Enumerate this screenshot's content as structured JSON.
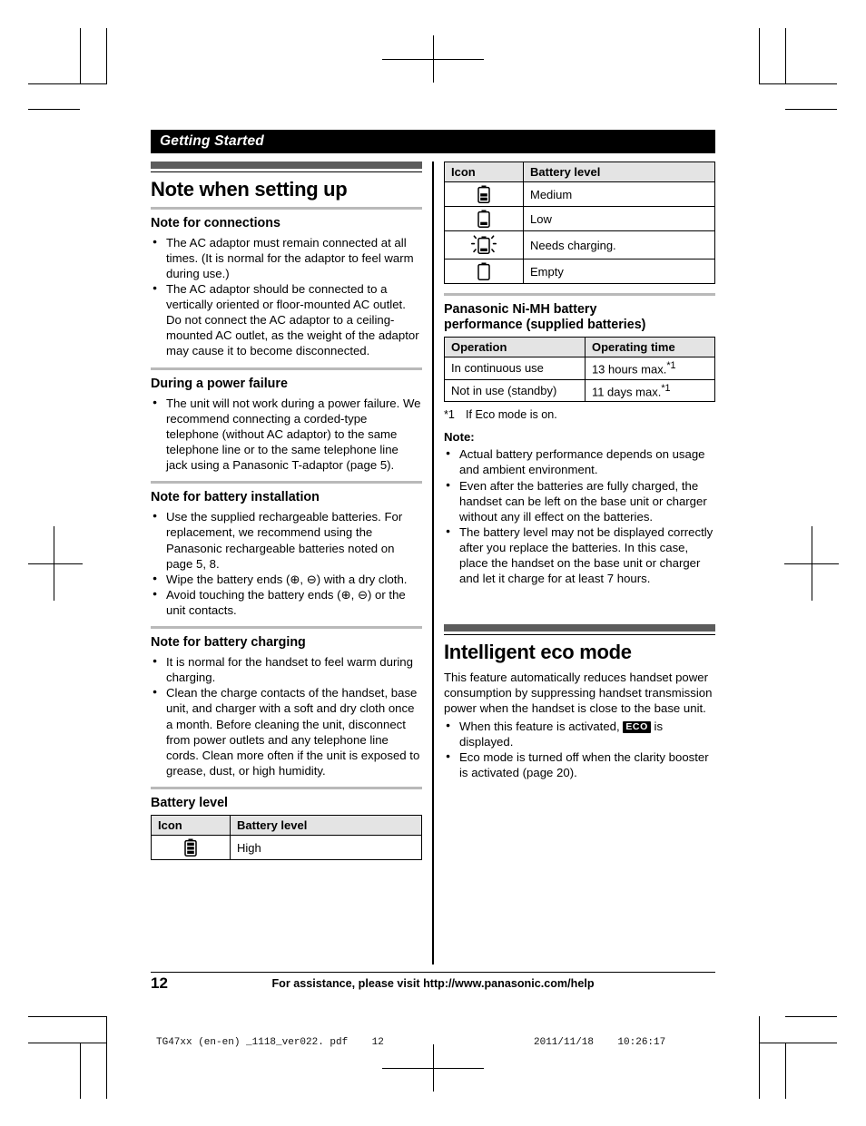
{
  "chapter": {
    "title": "Getting Started"
  },
  "left_column": {
    "section": {
      "title": "Note when setting up",
      "subsections": [
        {
          "heading": "Note for connections",
          "bullets": [
            "The AC adaptor must remain connected at all times. (It is normal for the adaptor to feel warm during use.)",
            "The AC adaptor should be connected to a vertically oriented or floor-mounted AC outlet. Do not connect the AC adaptor to a ceiling-mounted AC outlet, as the weight of the adaptor may cause it to become disconnected."
          ]
        },
        {
          "heading": "During a power failure",
          "bullets": [
            "The unit will not work during a power failure. We recommend connecting a corded-type telephone (without AC adaptor) to the same telephone line or to the same telephone line jack using a Panasonic T-adaptor (page 5)."
          ]
        },
        {
          "heading": "Note for battery installation",
          "bullets": [
            "Use the supplied rechargeable batteries. For replacement, we recommend using the Panasonic rechargeable batteries noted on page 5, 8.",
            "Wipe the battery ends (⊕, ⊖) with a dry cloth.",
            "Avoid touching the battery ends (⊕, ⊖) or the unit contacts."
          ]
        },
        {
          "heading": "Note for battery charging",
          "bullets": [
            "It is normal for the handset to feel warm during charging.",
            "Clean the charge contacts of the handset, base unit, and charger with a soft and dry cloth once a month. Before cleaning the unit, disconnect from power outlets and any telephone line cords. Clean more often if the unit is exposed to grease, dust, or high humidity."
          ]
        },
        {
          "heading": "Battery level"
        }
      ]
    },
    "battery_table_part1": {
      "headers": [
        "Icon",
        "Battery level"
      ],
      "rows": [
        {
          "icon": "battery-high-icon",
          "level": "High"
        }
      ]
    }
  },
  "right_column": {
    "battery_table_part2": {
      "headers": [
        "Icon",
        "Battery level"
      ],
      "rows": [
        {
          "icon": "battery-medium-icon",
          "level": "Medium"
        },
        {
          "icon": "battery-low-icon",
          "level": "Low"
        },
        {
          "icon": "battery-needs-charging-icon",
          "level": "Needs charging."
        },
        {
          "icon": "battery-empty-icon",
          "level": "Empty"
        }
      ]
    },
    "nimh_section": {
      "heading_line1": "Panasonic Ni-MH battery",
      "heading_line2": "performance (supplied batteries)",
      "table": {
        "headers": [
          "Operation",
          "Operating time"
        ],
        "rows": [
          {
            "operation": "In continuous use",
            "time": "13 hours max.",
            "sup": "*1"
          },
          {
            "operation": "Not in use (standby)",
            "time": "11 days max.",
            "sup": "*1"
          }
        ]
      },
      "footnote_mark": "*1",
      "footnote_text": "If Eco mode is on."
    },
    "note_block": {
      "label": "Note:",
      "bullets": [
        "Actual battery performance depends on usage and ambient environment.",
        "Even after the batteries are fully charged, the handset can be left on the base unit or charger without any ill effect on the batteries.",
        "The battery level may not be displayed correctly after you replace the batteries. In this case, place the handset on the base unit or charger and let it charge for at least 7 hours."
      ]
    },
    "eco_section": {
      "title": "Intelligent eco mode",
      "intro": "This feature automatically reduces handset power consumption by suppressing handset transmission power when the handset is close to the base unit.",
      "bullet1_before": "When this feature is activated, ",
      "bullet1_badge": "ECO",
      "bullet1_after": " is displayed.",
      "bullet2": "Eco mode is turned off when the clarity booster is activated (page 20)."
    }
  },
  "footer": {
    "page_number": "12",
    "assistance_text": "For assistance, please visit http://www.panasonic.com/help"
  },
  "print_slug": {
    "left": "TG47xx (en-en) _1118_ver022. pdf    12",
    "right": "2011/11/18    10:26:17"
  },
  "colors": {
    "chapter_bar": "#000000",
    "section_rule": "#5c5c5c",
    "sub_rule": "#b9b9b9",
    "table_header": "#e4e4e4"
  }
}
